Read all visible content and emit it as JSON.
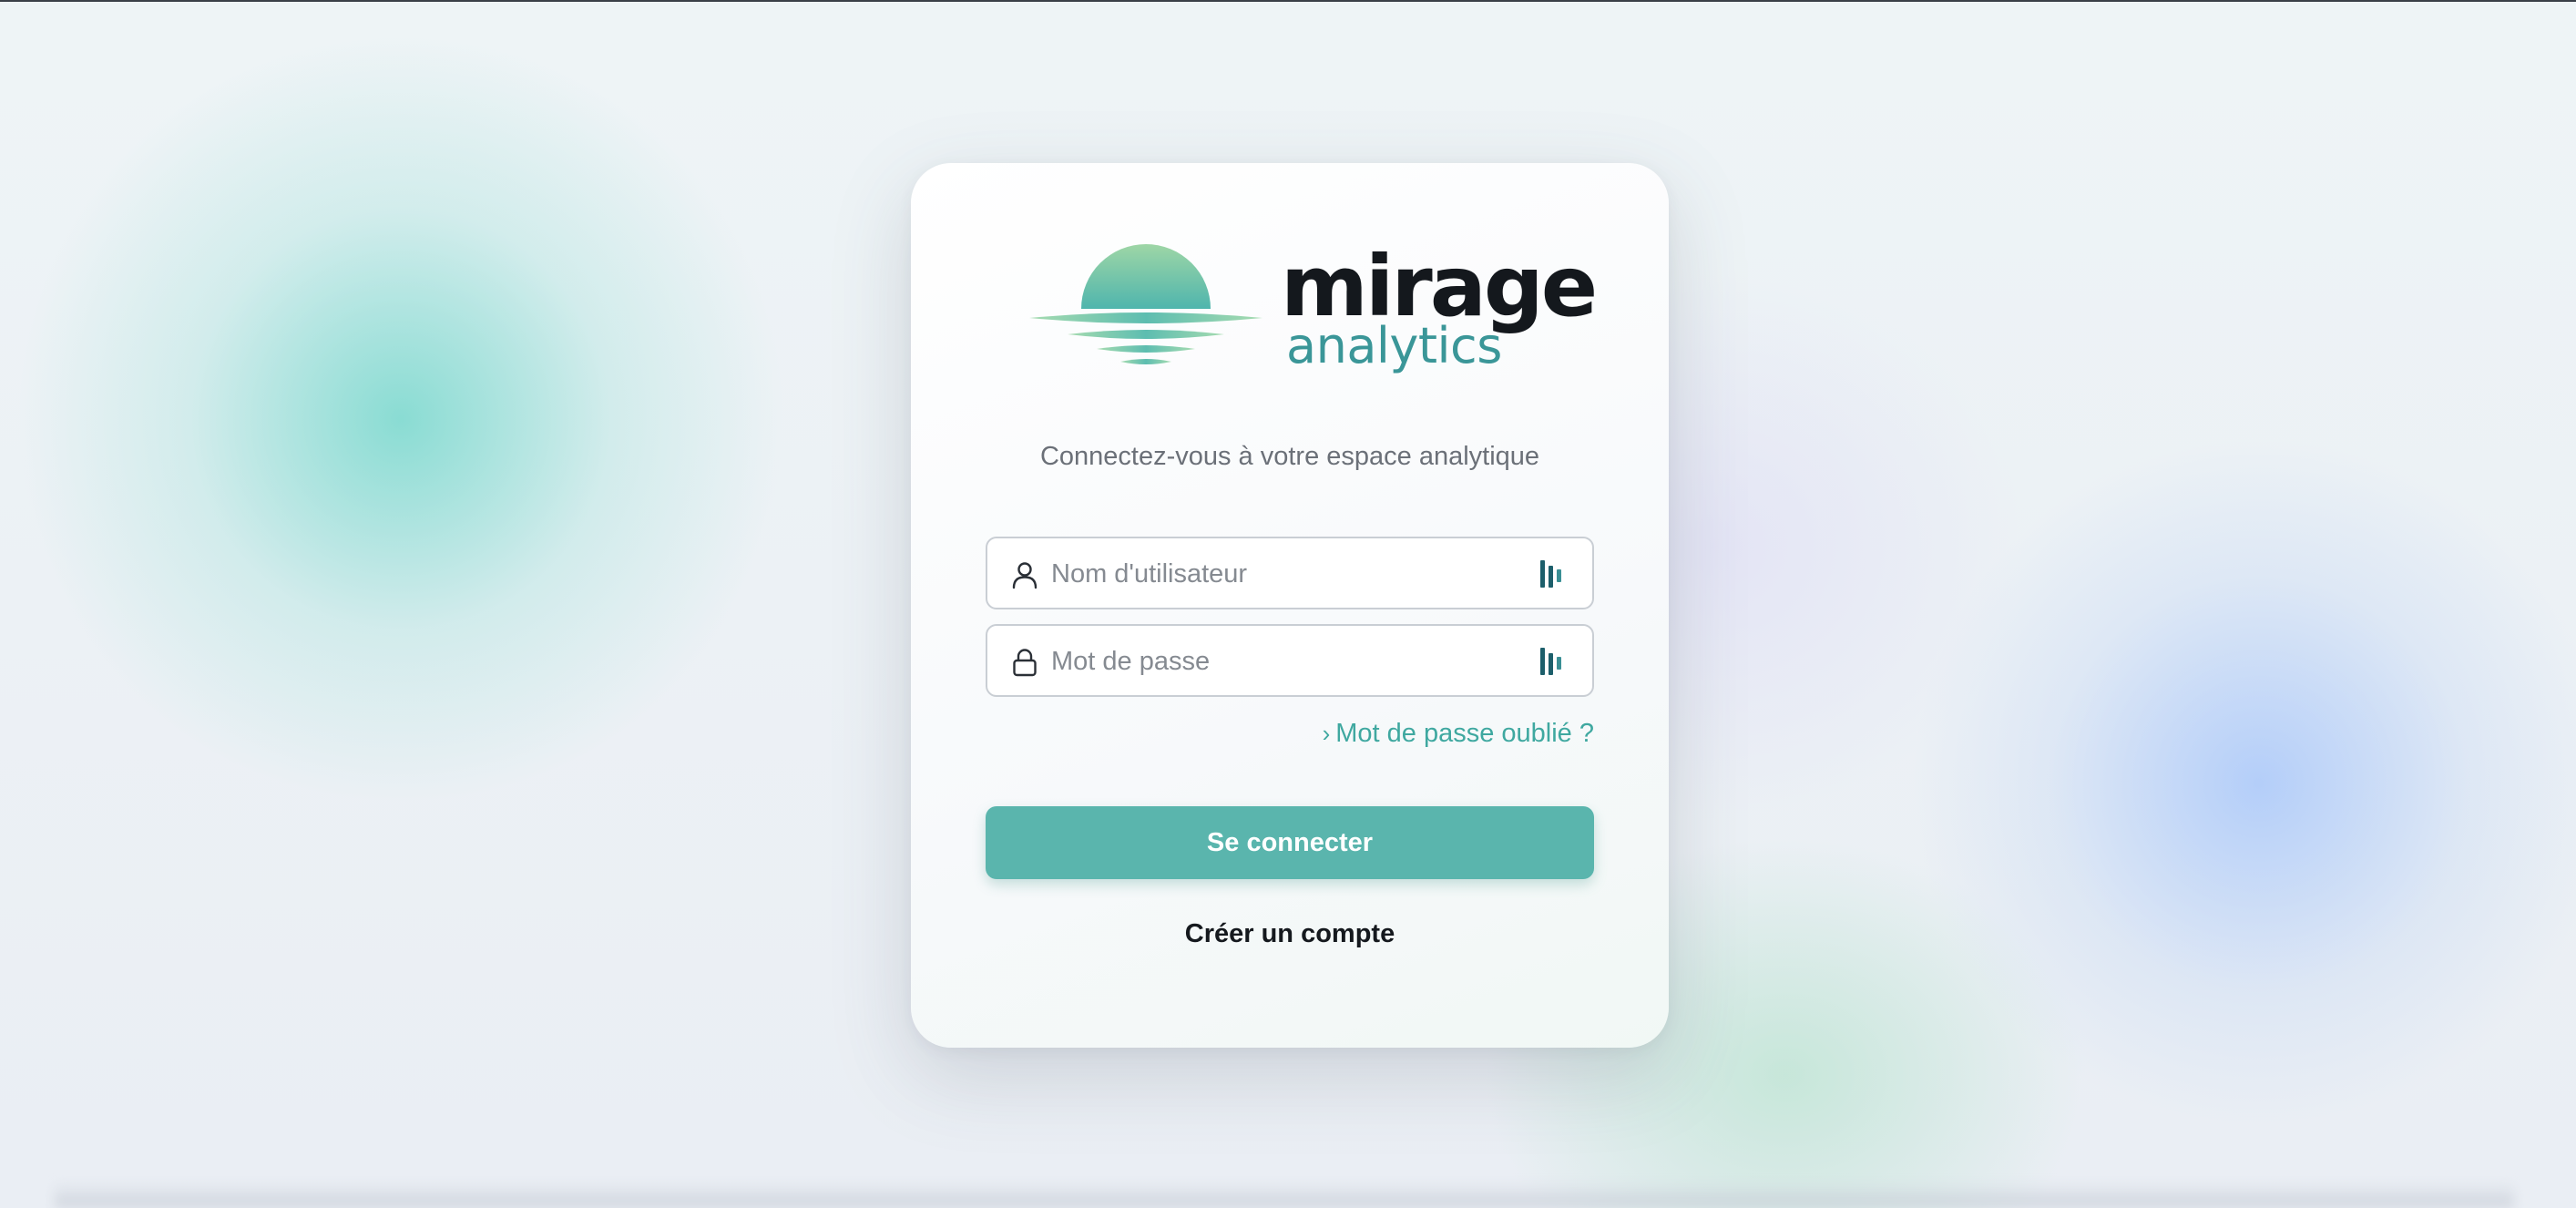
{
  "colors": {
    "accent": "#5ab5ad",
    "link": "#3fa8a0",
    "brand_dark": "#14181d",
    "brand_teal": "#3a9698"
  },
  "brand": {
    "name": "mirage",
    "tagline": "analytics",
    "logo_icon": "sunset-over-water-icon"
  },
  "login": {
    "subtitle": "Connectez-vous à votre espace analytique",
    "username": {
      "placeholder": "Nom d'utilisateur",
      "value": "",
      "icon": "user-icon",
      "trailing_icon": "password-manager-icon"
    },
    "password": {
      "placeholder": "Mot de passe",
      "value": "",
      "icon": "lock-icon",
      "trailing_icon": "password-manager-icon"
    },
    "forgot_link": "Mot de passe oublié ?",
    "forgot_icon": "chevron-right-icon",
    "submit_label": "Se connecter",
    "create_account": "Créer un compte"
  }
}
